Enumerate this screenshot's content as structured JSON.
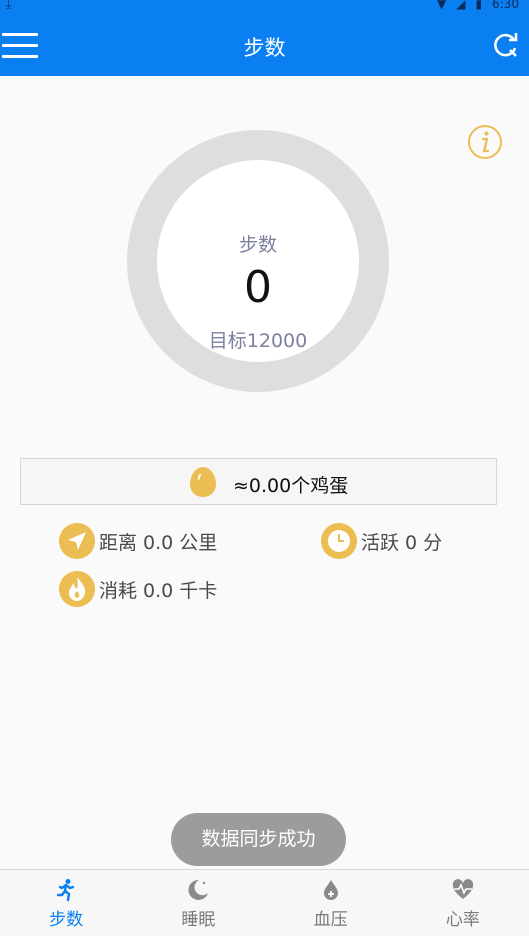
{
  "status_bar": {
    "time": "6:30"
  },
  "app_bar": {
    "title": "步数"
  },
  "ring": {
    "label": "步数",
    "value": "0",
    "goal": "目标12000",
    "progress": 0
  },
  "egg": {
    "text": "≈0.00个鸡蛋"
  },
  "stats": {
    "distance": "距离 0.0 公里",
    "active": "活跃 0 分",
    "calories": "消耗 0.0 千卡"
  },
  "toast": {
    "text": "数据同步成功"
  },
  "tabs": [
    {
      "label": "步数",
      "icon": "running-icon",
      "active": true
    },
    {
      "label": "睡眠",
      "icon": "moon-icon",
      "active": false
    },
    {
      "label": "血压",
      "icon": "blood-drop-icon",
      "active": false
    },
    {
      "label": "心率",
      "icon": "heart-rate-icon",
      "active": false
    }
  ],
  "colors": {
    "primary": "#0a7ff2",
    "accent": "#ecbd52",
    "ring": "#dedede"
  }
}
